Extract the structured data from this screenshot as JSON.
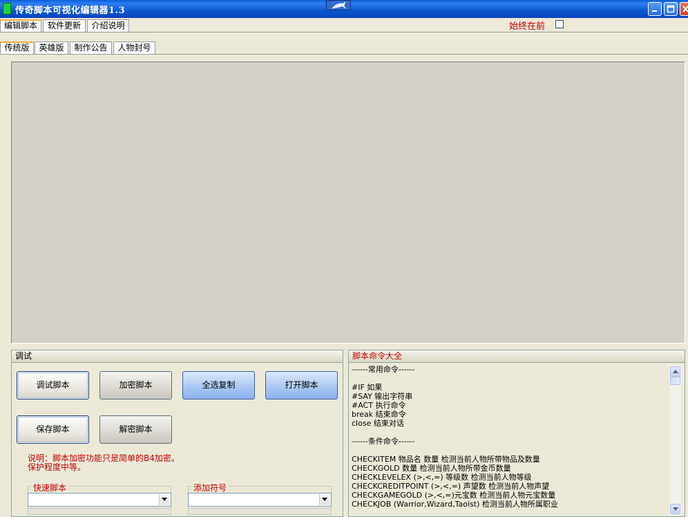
{
  "window": {
    "title": "传奇脚本可视化编辑器1.3"
  },
  "main_tabs": [
    "编辑脚本",
    "软件更新",
    "介绍说明"
  ],
  "always_on_top": {
    "label": "始终在前",
    "checked": false
  },
  "sub_tabs": [
    "传统版",
    "英雄版",
    "制作公告",
    "人物封号"
  ],
  "debug_panel": {
    "title": "调试",
    "buttons": {
      "debug": "调试脚本",
      "encrypt": "加密脚本",
      "select_copy": "全选复制",
      "open": "打开脚本",
      "save": "保存脚本",
      "decrypt": "解密脚本"
    },
    "note_line1": "说明：脚本加密功能只是简单的B4加密。",
    "note_line2": "保护程度中等。",
    "quick_script_label": "快速脚本",
    "quick_script_value": "",
    "add_symbol_label": "添加符号",
    "add_symbol_value": ""
  },
  "commands_panel": {
    "title": "脚本命令大全",
    "lines": [
      "------常用命令------",
      "",
      "#IF 如果",
      "#SAY 输出字符串",
      "#ACT 执行命令",
      "break 结束命令",
      "close 结束对话",
      "",
      "------条件命令------",
      "",
      "CHECKITEM 物品名 数量 检测当前人物所带物品及数量",
      "CHECKGOLD 数量 检测当前人物所带金币数量",
      "CHECKLEVELEX (>,<,=) 等级数 检测当前人物等级",
      "CHECKCREDITPOINT (>,<,=) 声望数 检测当前人物声望",
      "CHECKGAMEGOLD (>,<,=)元宝数 检测当前人物元宝数量",
      "CHECKJOB (Warrior,Wizard,Taoist) 检测当前人物所属职业"
    ]
  },
  "colors": {
    "titlebar": "#0b57d0",
    "accent_red": "#c00000",
    "blue_button": "#a8c6f3",
    "canvas": "#d4d0c8"
  }
}
